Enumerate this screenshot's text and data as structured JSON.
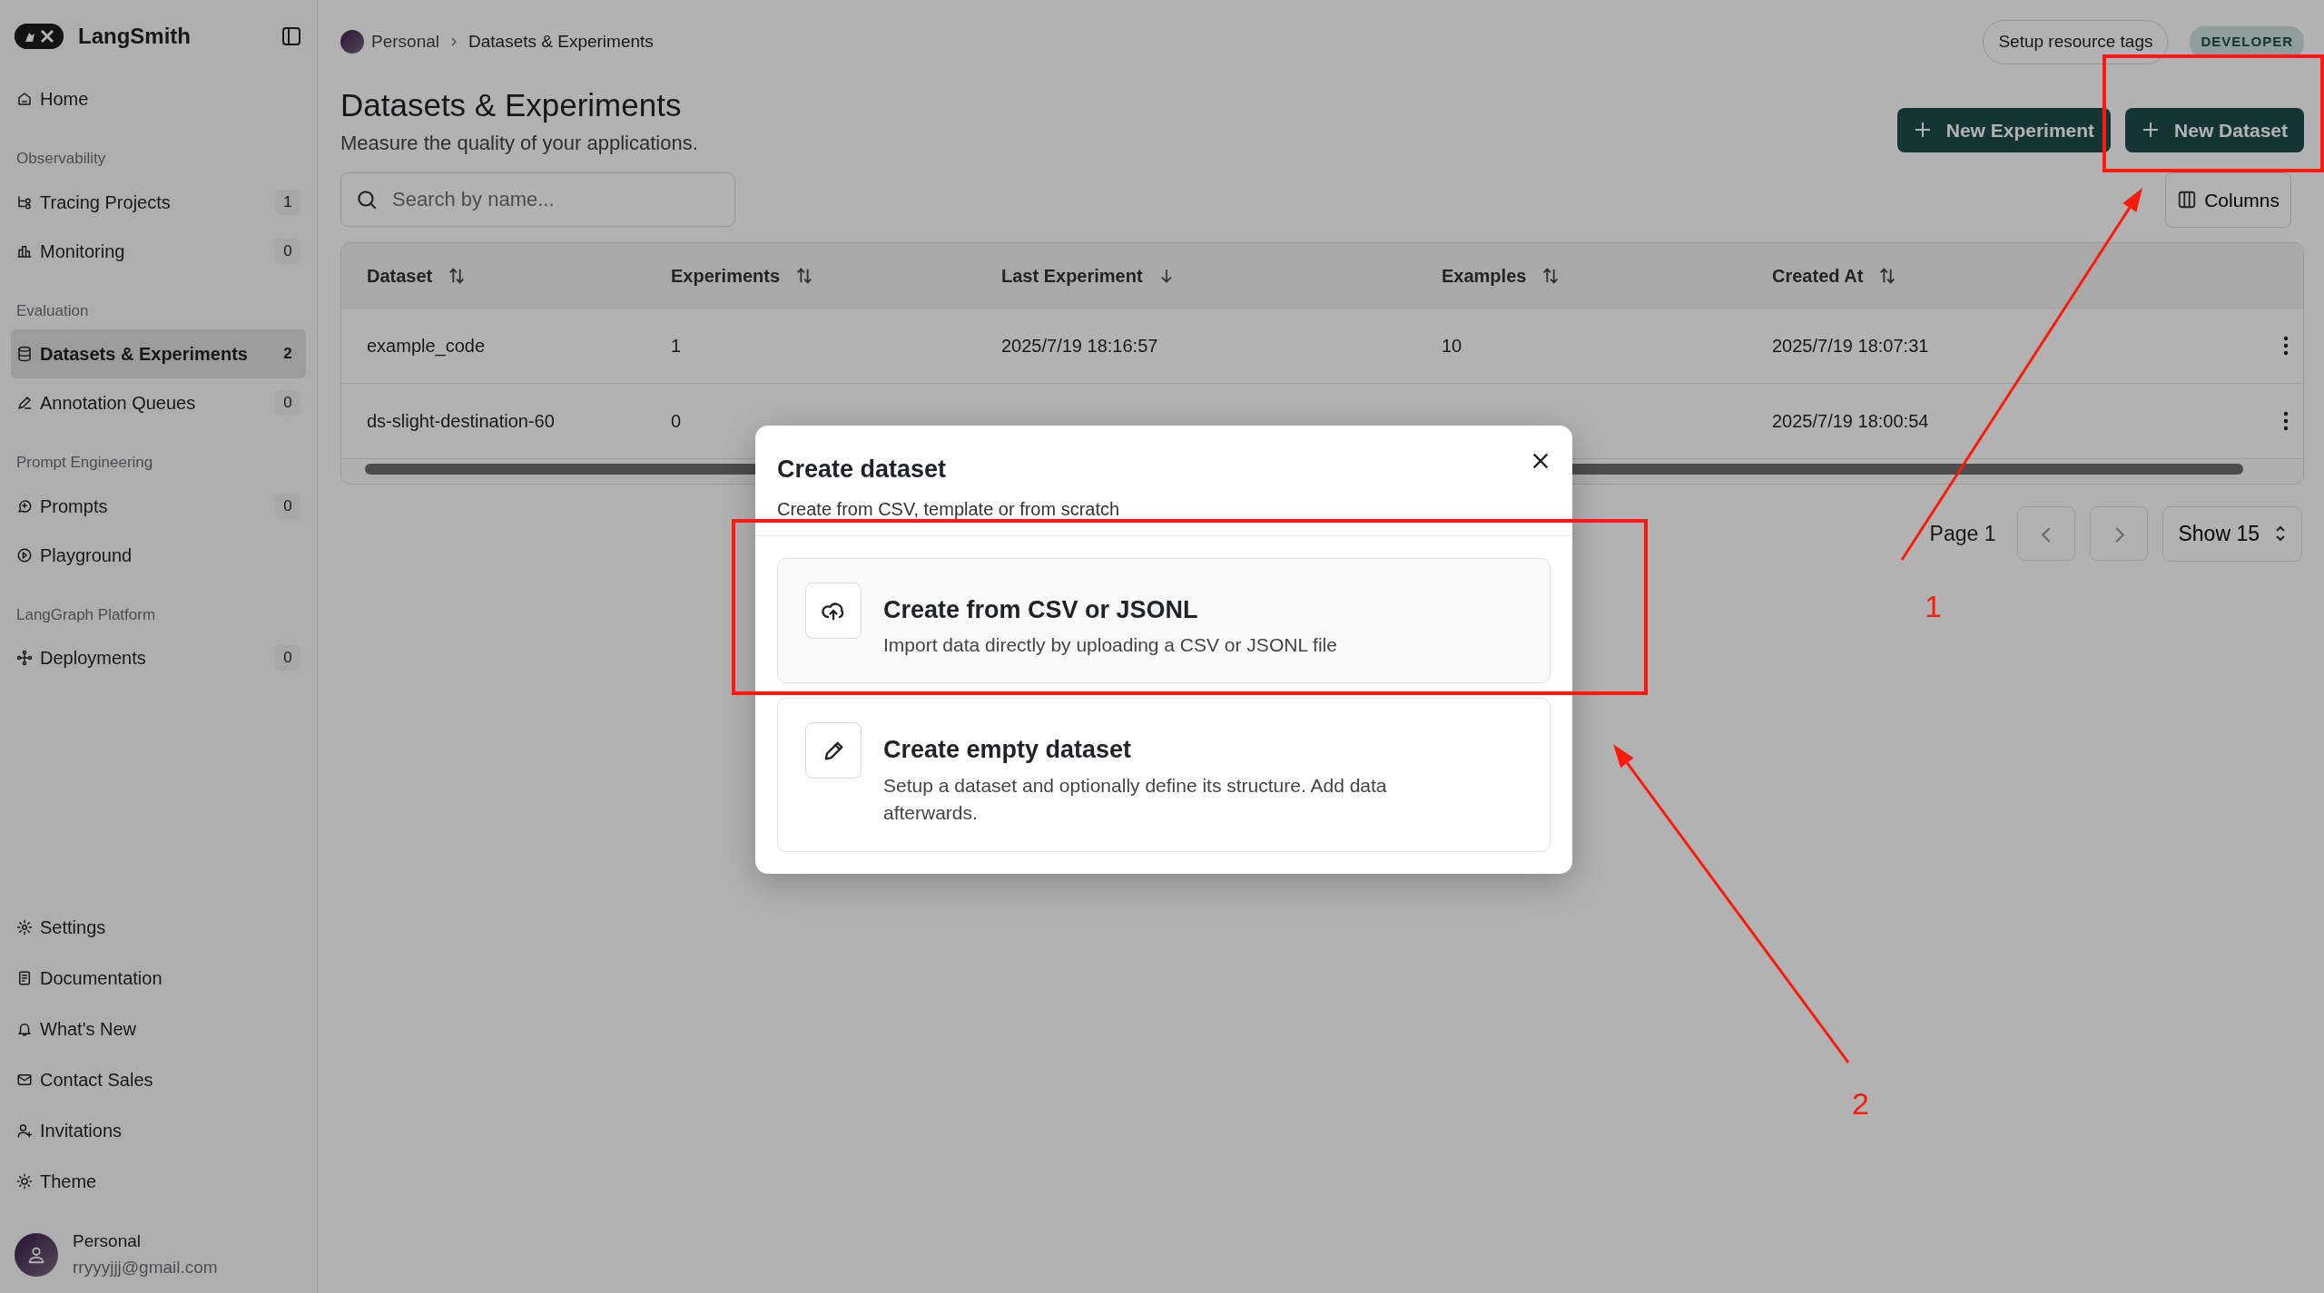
{
  "sidebar": {
    "brand": "LangSmith",
    "groups": [
      {
        "items": [
          {
            "label": "Home",
            "selected": false
          }
        ]
      },
      {
        "heading": "Observability",
        "items": [
          {
            "label": "Tracing Projects",
            "count": "1",
            "selected": false
          },
          {
            "label": "Monitoring",
            "count": "0",
            "selected": false
          }
        ]
      },
      {
        "heading": "Evaluation",
        "items": [
          {
            "label": "Datasets & Experiments",
            "count": "2",
            "selected": true
          },
          {
            "label": "Annotation Queues",
            "count": "0",
            "selected": false
          }
        ]
      },
      {
        "heading": "Prompt Engineering",
        "items": [
          {
            "label": "Prompts",
            "count": "0",
            "selected": false
          },
          {
            "label": "Playground",
            "selected": false
          }
        ]
      },
      {
        "heading": "LangGraph Platform",
        "items": [
          {
            "label": "Deployments",
            "count": "0",
            "selected": false
          }
        ]
      }
    ],
    "bottom_items": [
      "Settings",
      "Documentation",
      "What's New",
      "Contact Sales",
      "Invitations",
      "Theme"
    ],
    "user": {
      "name": "Personal",
      "email": "rryyyjjj@gmail.com"
    }
  },
  "breadcrumb": [
    "Personal",
    "Datasets & Experiments"
  ],
  "top_actions": {
    "tags_button": "Setup resource tags",
    "plan_badge": "DEVELOPER"
  },
  "page": {
    "title": "Datasets & Experiments",
    "subtitle": "Measure the quality of your applications.",
    "buttons": [
      "New Experiment",
      "New Dataset"
    ],
    "search": {
      "placeholder": "Search by name..."
    },
    "columns_button": "Columns"
  },
  "table": {
    "columns": [
      {
        "label": "Dataset",
        "kind": "sortable"
      },
      {
        "label": "Experiments",
        "kind": "sortable"
      },
      {
        "label": "Last Experiment",
        "kind": "sorted"
      },
      {
        "label": "Examples",
        "kind": "sortable"
      },
      {
        "label": "Created At",
        "kind": "sortable"
      }
    ],
    "rows": [
      {
        "cells": [
          "example_code",
          "1",
          "2025/7/19 18:16:57",
          "10",
          "2025/7/19 18:07:31"
        ]
      },
      {
        "cells": [
          "ds-slight-destination-60",
          "0",
          null,
          null,
          "2025/7/19 18:00:54"
        ]
      }
    ]
  },
  "pagination": {
    "page": "Page 1",
    "page_size": "Show 15"
  },
  "modal": {
    "title": "Create dataset",
    "subtitle": "Create from CSV, template or from scratch",
    "options": [
      {
        "title": "Create from CSV or JSONL",
        "description": "Import data directly by uploading a CSV or JSONL file"
      },
      {
        "title": "Create empty dataset",
        "description": "Setup a dataset and optionally define its structure. Add data afterwards."
      }
    ]
  },
  "annotations": [
    {
      "label": "1"
    },
    {
      "label": "2"
    }
  ]
}
